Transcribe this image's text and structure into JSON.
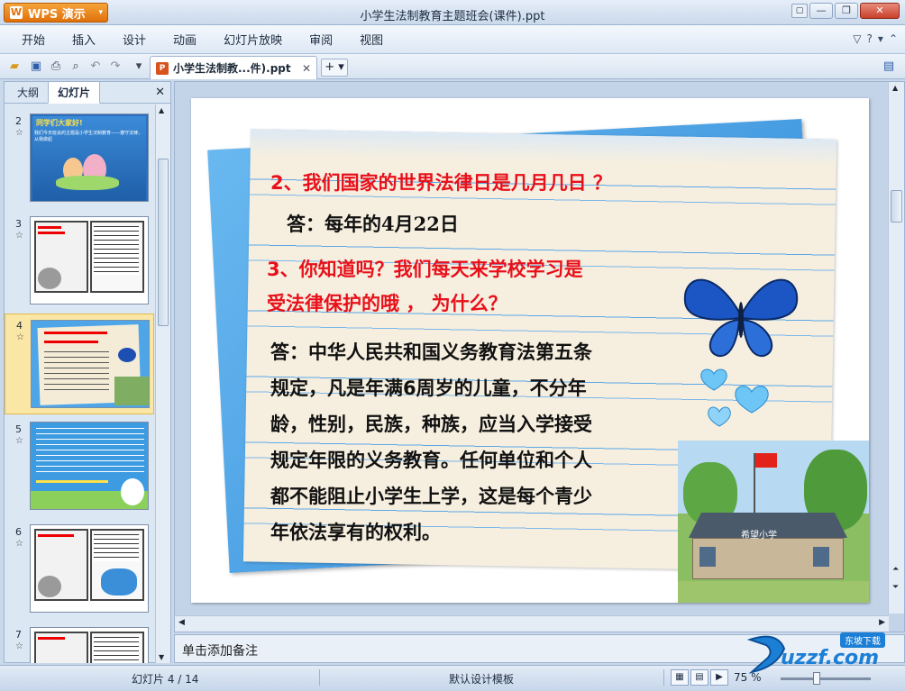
{
  "app": {
    "button_label": "WPS 演示",
    "window_title": "小学生法制教育主题班会(课件).ppt"
  },
  "menu": {
    "items": [
      "开始",
      "插入",
      "设计",
      "动画",
      "幻灯片放映",
      "审阅",
      "视图"
    ]
  },
  "toolbar": {
    "doc_tab_label": "小学生法制教...件).ppt",
    "new_tab_label": "+"
  },
  "left_panel": {
    "tabs": [
      "大纲",
      "幻灯片"
    ],
    "thumbnails": [
      {
        "number": "2",
        "selected": false
      },
      {
        "number": "3",
        "selected": false
      },
      {
        "number": "4",
        "selected": true
      },
      {
        "number": "5",
        "selected": false
      },
      {
        "number": "6",
        "selected": false
      },
      {
        "number": "7",
        "selected": false
      }
    ],
    "thumb2_heading": "同学们大家好!",
    "thumb2_body": "我们今天班会的主题是小学生法制教育——遵守法律，从我做起"
  },
  "slide": {
    "question2": "2、我们国家的世界法律日是几月几日 ？",
    "answer2": "答：每年的4月22日",
    "question3_line1": "3、你知道吗？我们每天来学校学习是",
    "question3_line2": "受法律保护的哦 ， 为什么？",
    "answer3_lines": [
      "答：中华人民共和国义务教育法第五条",
      "规定，凡是年满6周岁的儿童，不分年",
      "龄，性别，民族，种族，应当入学接受",
      "规定年限的义务教育。任何单位和个人",
      "都不能阻止小学生上学，这是每个青少",
      "年依法享有的权利。"
    ],
    "school_sign": "希望小学",
    "colors": {
      "question_red": "#e8101a",
      "paper": "#f6efe0",
      "paper_blue": "#3f9be0"
    }
  },
  "notes": {
    "placeholder": "单击添加备注"
  },
  "status": {
    "slide_counter": "幻灯片 4 / 14",
    "template_name": "默认设计模板",
    "zoom_text": "75 %"
  },
  "watermark": {
    "text": "uzzf.com",
    "sub": "东坡下载"
  }
}
